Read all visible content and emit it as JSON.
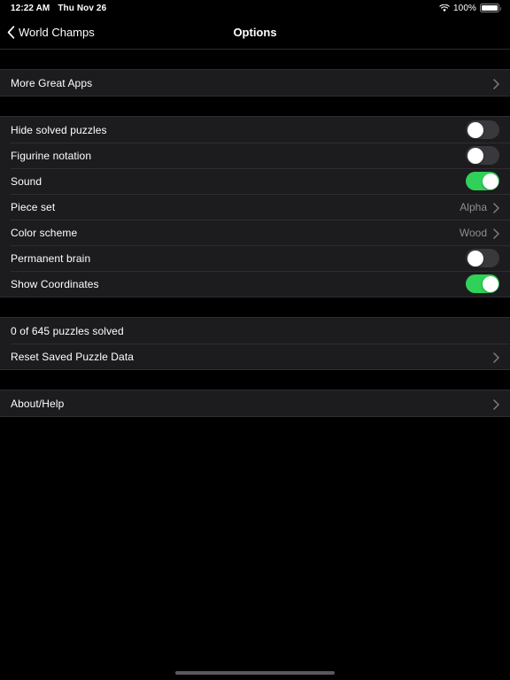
{
  "status_bar": {
    "time": "12:22 AM",
    "date": "Thu Nov 26",
    "battery_percent": "100%",
    "wifi_icon": "wifi-icon",
    "battery_icon": "battery-full-icon"
  },
  "nav": {
    "back_label": "World Champs",
    "back_icon": "chevron-left-icon",
    "title": "Options"
  },
  "sections": {
    "apps": {
      "rows": [
        {
          "label": "More Great Apps",
          "type": "disclosure",
          "accessory_icon": "chevron-right-icon"
        }
      ]
    },
    "settings": {
      "rows": [
        {
          "label": "Hide solved puzzles",
          "type": "toggle",
          "on": false
        },
        {
          "label": "Figurine notation",
          "type": "toggle",
          "on": false
        },
        {
          "label": "Sound",
          "type": "toggle",
          "on": true
        },
        {
          "label": "Piece set",
          "type": "value",
          "value": "Alpha",
          "accessory_icon": "chevron-right-icon"
        },
        {
          "label": "Color scheme",
          "type": "value",
          "value": "Wood",
          "accessory_icon": "chevron-right-icon"
        },
        {
          "label": "Permanent brain",
          "type": "toggle",
          "on": false
        },
        {
          "label": "Show Coordinates",
          "type": "toggle",
          "on": true
        }
      ]
    },
    "progress": {
      "rows": [
        {
          "label": "0 of 645 puzzles solved",
          "type": "static"
        },
        {
          "label": "Reset Saved Puzzle Data",
          "type": "disclosure",
          "accessory_icon": "chevron-right-icon"
        }
      ]
    },
    "about": {
      "rows": [
        {
          "label": "About/Help",
          "type": "disclosure",
          "accessory_icon": "chevron-right-icon"
        }
      ]
    }
  },
  "colors": {
    "accent_green": "#30d158",
    "row_background": "#1c1c1e",
    "page_background": "#000000",
    "secondary_text": "#8e8e93"
  },
  "home_indicator": "home-indicator"
}
